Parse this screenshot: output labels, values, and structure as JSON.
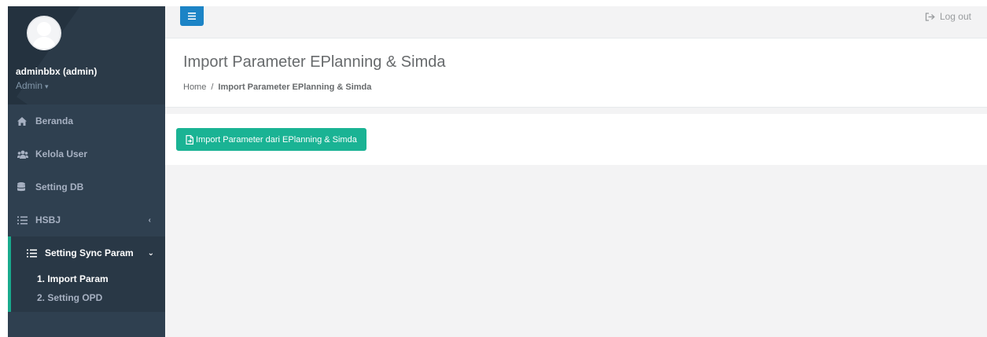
{
  "user": {
    "name": "adminbbx (admin)",
    "role": "Admin",
    "role_caret": "▾"
  },
  "sidebar": {
    "items": [
      {
        "label": "Beranda",
        "icon": "home-icon"
      },
      {
        "label": "Kelola User",
        "icon": "users-icon"
      },
      {
        "label": "Setting DB",
        "icon": "database-icon"
      },
      {
        "label": "HSBJ",
        "icon": "list-icon",
        "arrow": "‹"
      },
      {
        "label": "Setting Sync Param",
        "icon": "list-icon",
        "arrow": "⌄"
      }
    ],
    "subitems": [
      {
        "label": "1. Import Param"
      },
      {
        "label": "2. Setting OPD"
      }
    ]
  },
  "topbar": {
    "logout_label": "Log out"
  },
  "page": {
    "title": "Import Parameter EPlanning & Simda",
    "breadcrumb": {
      "home": "Home",
      "separator": "/",
      "current": "Import Parameter EPlanning & Simda"
    }
  },
  "actions": {
    "import_label": "Import Parameter dari EPlanning & Simda"
  },
  "colors": {
    "sidebar": "#2f4050",
    "accent_green": "#1ab394",
    "accent_blue": "#1c84c6",
    "background": "#f3f3f4"
  }
}
